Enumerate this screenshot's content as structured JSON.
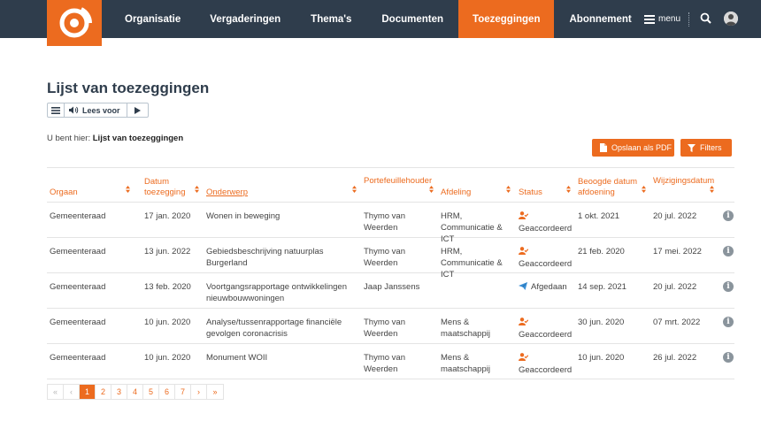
{
  "nav": {
    "items": [
      {
        "label": "Organisatie",
        "active": false
      },
      {
        "label": "Vergaderingen",
        "active": false
      },
      {
        "label": "Thema's",
        "active": false
      },
      {
        "label": "Documenten",
        "active": false
      },
      {
        "label": "Toezeggingen",
        "active": true
      },
      {
        "label": "Abonnement",
        "active": false
      }
    ],
    "menu_label": "menu"
  },
  "page": {
    "title": "Lijst van toezeggingen",
    "readspeaker_label": "Lees voor",
    "breadcrumb_prefix": "U bent hier: ",
    "breadcrumb_current": "Lijst van toezeggingen",
    "btn_pdf": "Opslaan als PDF",
    "btn_filters": "Filters"
  },
  "table": {
    "headers": {
      "organ": "Orgaan",
      "date_line1": "Datum",
      "date_line2": "toezegging",
      "subject": "Onderwerp",
      "portfolio": "Portefeuillehouder",
      "department": "Afdeling",
      "status": "Status",
      "due_line1": "Beoogde datum",
      "due_line2": "afdoening",
      "modified": "Wijzigingsdatum"
    },
    "rows": [
      {
        "organ": "Gemeenteraad",
        "date": "17 jan. 2020",
        "subject": "Wonen in beweging",
        "portfolio": "Thymo van Weerden",
        "department": "HRM, Communicatie & ICT",
        "status": "Geaccordeerd",
        "status_icon": "user-check-icon",
        "due": "1 okt. 2021",
        "modified": "20 jul. 2022"
      },
      {
        "organ": "Gemeenteraad",
        "date": "13 jun. 2022",
        "subject": "Gebiedsbeschrijving natuurplas Burgerland",
        "portfolio": "Thymo van Weerden",
        "department": "HRM, Communicatie & ICT",
        "status": "Geaccordeerd",
        "status_icon": "user-check-icon",
        "due": "21 feb. 2020",
        "modified": "17 mei. 2022"
      },
      {
        "organ": "Gemeenteraad",
        "date": "13 feb. 2020",
        "subject": "Voortgangsrapportage ontwikkelingen nieuwbouwwoningen",
        "portfolio": "Jaap Janssens",
        "department": "",
        "status": "Afgedaan",
        "status_icon": "paper-plane-icon",
        "due": "14 sep. 2021",
        "modified": "20 jul. 2022"
      },
      {
        "organ": "Gemeenteraad",
        "date": "10 jun. 2020",
        "subject": "Analyse/tussenrapportage financiële gevolgen coronacrisis",
        "portfolio": "Thymo van Weerden",
        "department": "Mens & maatschappij",
        "status": "Geaccordeerd",
        "status_icon": "user-check-icon",
        "due": "30 jun. 2020",
        "modified": "07 mrt. 2022"
      },
      {
        "organ": "Gemeenteraad",
        "date": "10 jun. 2020",
        "subject": "Monument WOII",
        "portfolio": "Thymo van Weerden",
        "department": "Mens & maatschappij",
        "status": "Geaccordeerd",
        "status_icon": "user-check-icon",
        "due": "10 jun. 2020",
        "modified": "26 jul. 2022"
      }
    ]
  },
  "pagination": {
    "first": "«",
    "prev": "‹",
    "pages": [
      "1",
      "2",
      "3",
      "4",
      "5",
      "6",
      "7"
    ],
    "current": "1",
    "next": "›",
    "last": "»"
  },
  "colors": {
    "accent": "#ec6b1f",
    "navbar": "#2f3d4c"
  }
}
